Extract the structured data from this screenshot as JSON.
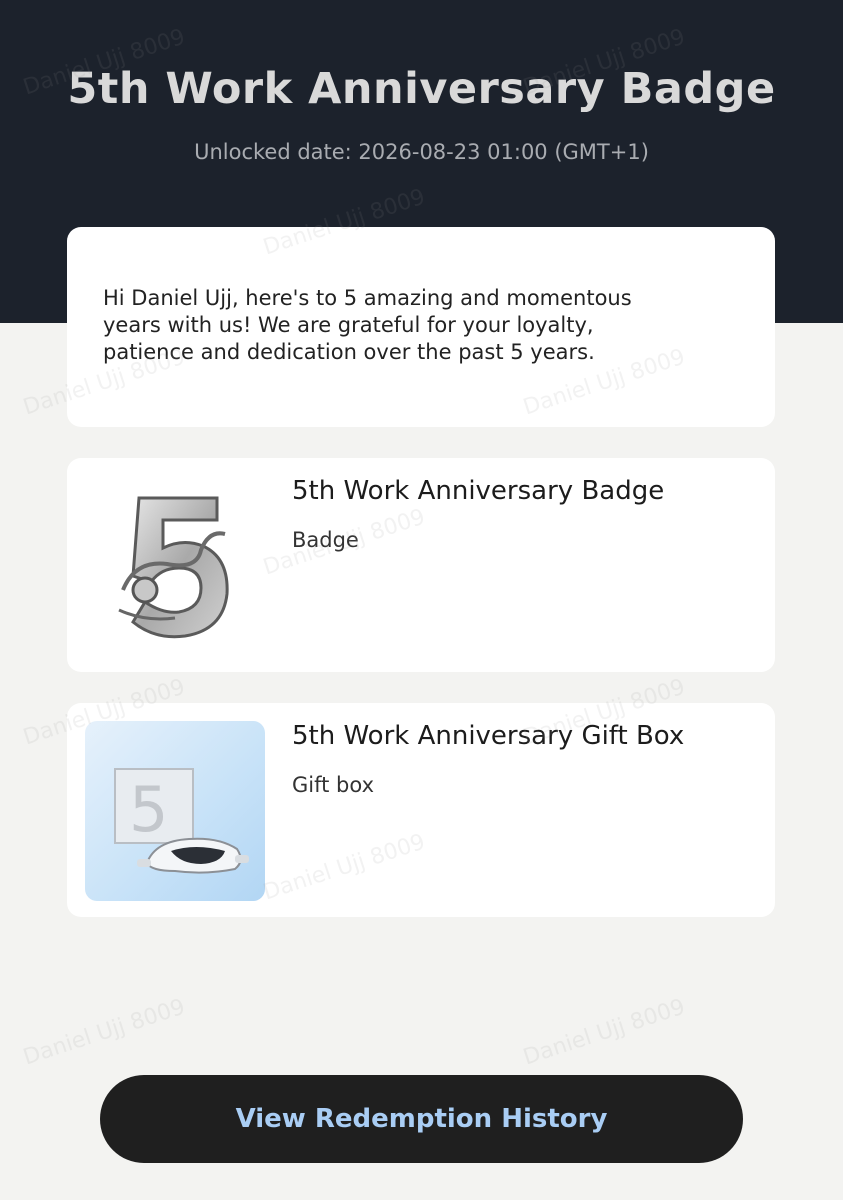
{
  "header": {
    "title": "5th Work Anniversary Badge",
    "unlocked_date": "Unlocked date: 2026-08-23 01:00 (GMT+1)"
  },
  "message": {
    "line1": "Hi Daniel Ujj, here's to 5 amazing and momentous",
    "line2": "years with us! We are grateful for your loyalty,",
    "line3": "patience and dedication over the past 5 years."
  },
  "items": [
    {
      "title": "5th Work Anniversary Badge",
      "type": "Badge",
      "icon": "silver-5-badge-icon"
    },
    {
      "title": "5th Work Anniversary Gift Box",
      "type": "Gift box",
      "icon": "gift-box-vr-headset-icon"
    }
  ],
  "actions": {
    "view_history": "View Redemption History"
  },
  "watermark": "Daniel Ujj 8009",
  "colors": {
    "header_bg": "#1c222c",
    "page_bg": "#f3f3f1",
    "button_bg": "#1f1f1f",
    "button_text": "#a9cdf4"
  }
}
